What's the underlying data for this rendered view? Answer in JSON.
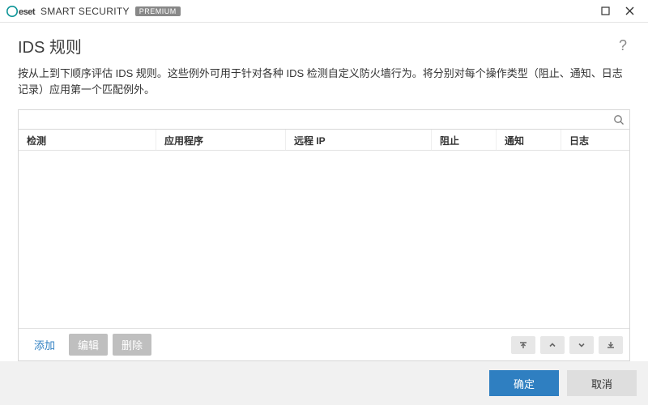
{
  "titlebar": {
    "brand_eset": "eset",
    "brand_smart": "SMART SECURITY",
    "brand_badge": "PREMIUM"
  },
  "heading": "IDS 规则",
  "description": "按从上到下顺序评估 IDS 规则。这些例外可用于针对各种 IDS 检测自定义防火墙行为。将分别对每个操作类型（阻止、通知、日志记录）应用第一个匹配例外。",
  "search": {
    "placeholder": ""
  },
  "columns": {
    "detect": "检测",
    "app": "应用程序",
    "remote": "远程 IP",
    "block": "阻止",
    "notify": "通知",
    "log": "日志"
  },
  "toolbar": {
    "add": "添加",
    "edit": "编辑",
    "delete": "删除"
  },
  "footer": {
    "ok": "确定",
    "cancel": "取消"
  }
}
